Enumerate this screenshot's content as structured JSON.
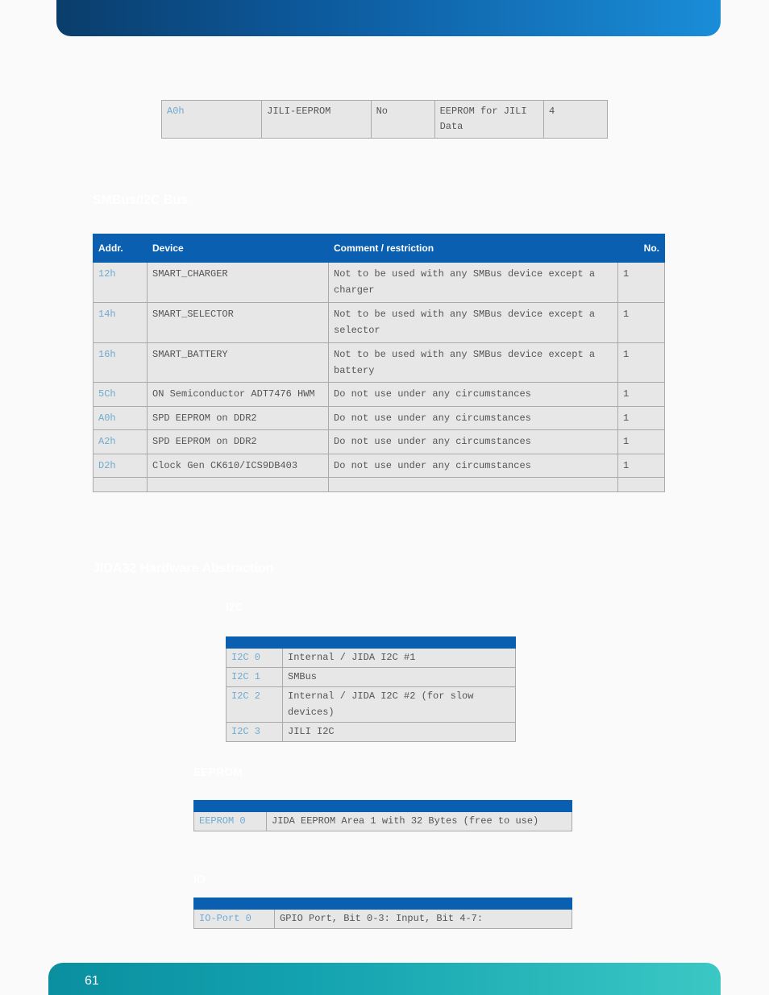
{
  "table1": {
    "row": {
      "addr": "A0h",
      "device": "JILI-EEPROM",
      "assigned": "No",
      "desc": "EEPROM for JILI Data",
      "num": "4"
    }
  },
  "section_smbus": "SMBus/I2C Bus",
  "table2": {
    "headers": {
      "c1": "Addr.",
      "c2": "Device",
      "c3": "Comment / restriction",
      "c4": "No."
    },
    "rows": [
      {
        "addr": "12h",
        "device": "SMART_CHARGER",
        "comment": "Not to be used with any SMBus device except a charger",
        "num": "1"
      },
      {
        "addr": "14h",
        "device": "SMART_SELECTOR",
        "comment": "Not to be used with any SMBus device except a selector",
        "num": "1"
      },
      {
        "addr": "16h",
        "device": "SMART_BATTERY",
        "comment": "Not to be used with any SMBus device except a battery",
        "num": "1"
      },
      {
        "addr": "5Ch",
        "device": "ON Semiconductor ADT7476 HWM",
        "comment": "Do not use under any circumstances",
        "num": "1"
      },
      {
        "addr": "A0h",
        "device": "SPD EEPROM on DDR2",
        "comment": "Do not use under any circumstances",
        "num": "1"
      },
      {
        "addr": "A2h",
        "device": "SPD EEPROM on DDR2",
        "comment": "Do not use under any circumstances",
        "num": "1"
      },
      {
        "addr": "D2h",
        "device": "Clock Gen CK610/ICS9DB403",
        "comment": "Do not use under any circumstances",
        "num": "1"
      }
    ]
  },
  "section_jida": "JIDA32 Hardware Abstraction",
  "sub_i2c": "I2C",
  "table3": {
    "header": {
      "c1": "",
      "c2": ""
    },
    "rows": [
      {
        "k": "I2C 0",
        "v": "Internal / JIDA I2C #1"
      },
      {
        "k": "I2C 1",
        "v": "SMBus"
      },
      {
        "k": "I2C 2",
        "v": "Internal / JIDA I2C #2 (for slow devices)"
      },
      {
        "k": "I2C 3",
        "v": "JILI I2C"
      }
    ]
  },
  "sub_eeprom": "EEPROM",
  "table4": {
    "header": {
      "c1": "",
      "c2": ""
    },
    "rows": [
      {
        "k": "EEPROM 0",
        "v": "JIDA EEPROM Area 1 with 32 Bytes (free to use)"
      }
    ]
  },
  "sub_io": "IO",
  "table5": {
    "header": {
      "c1": "",
      "c2": ""
    },
    "rows": [
      {
        "k": "IO-Port 0",
        "v": "GPIO Port, Bit 0-3: Input, Bit 4-7:"
      }
    ]
  },
  "page_num": "61"
}
